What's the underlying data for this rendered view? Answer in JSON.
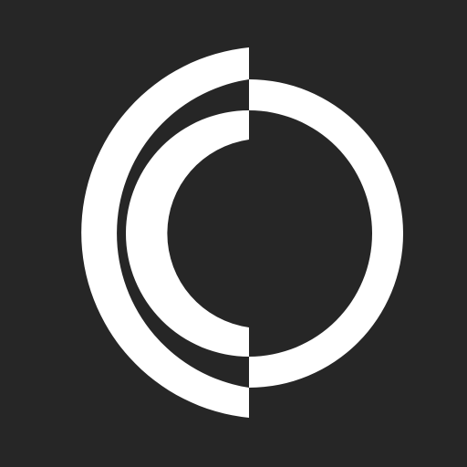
{
  "app_icon": {
    "name": "app-logo",
    "colors": {
      "background": "#262626",
      "foreground": "#ffffff"
    }
  }
}
